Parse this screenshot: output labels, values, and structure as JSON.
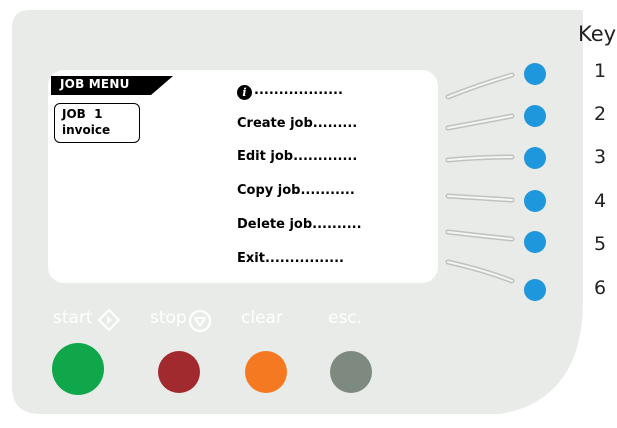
{
  "display": {
    "menu_title": "JOB MENU",
    "job_id": "JOB  1",
    "job_name": "invoice",
    "items": [
      {
        "label": "",
        "dots": "..................",
        "icon": "info-icon"
      },
      {
        "label": "Create job",
        "dots": "........."
      },
      {
        "label": "Edit job",
        "dots": "............."
      },
      {
        "label": "Copy job",
        "dots": "..........."
      },
      {
        "label": "Delete job",
        "dots": ".........."
      },
      {
        "label": "Exit",
        "dots": "................"
      }
    ]
  },
  "key": {
    "title": "Key",
    "numbers": [
      "1",
      "2",
      "3",
      "4",
      "5",
      "6"
    ]
  },
  "controls": {
    "start": {
      "label": "start",
      "icon": "diamond-start-icon",
      "color": "#10a64a"
    },
    "stop": {
      "label": "stop",
      "icon": "circle-stop-icon",
      "color": "#a12a2e"
    },
    "clear": {
      "label": "clear",
      "color": "#f47920"
    },
    "esc": {
      "label": "esc.",
      "color": "#7e8a80"
    }
  },
  "colors": {
    "panel": "#e8ebe8",
    "softkey": "#1f97dd",
    "connector": "#c3c7c4"
  }
}
